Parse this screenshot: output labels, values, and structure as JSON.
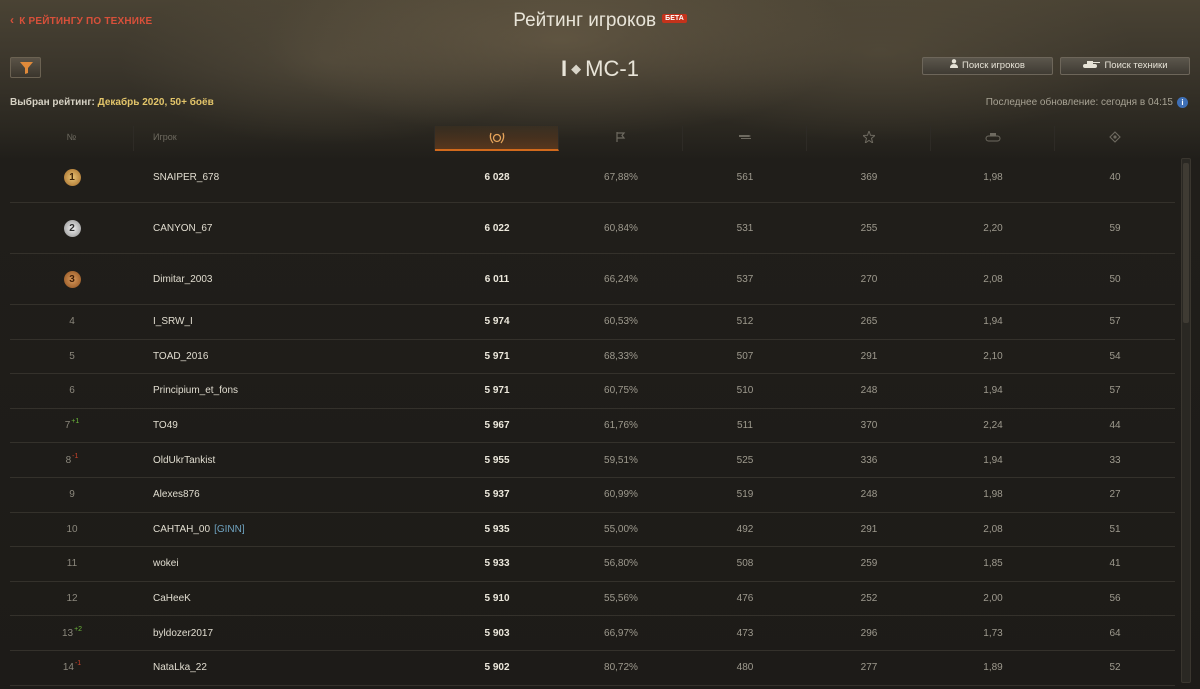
{
  "header": {
    "back_label": "К РЕЙТИНГУ ПО ТЕХНИКЕ",
    "title": "Рейтинг игроков",
    "beta": "БЕТА",
    "vehicle_tier": "I",
    "vehicle_name": "МС-1",
    "search_players": "Поиск игроков",
    "search_vehicles": "Поиск техники"
  },
  "info": {
    "chosen_label": "Выбран рейтинг:",
    "chosen_value": "Декабрь 2020, 50+ боёв",
    "updated": "Последнее обновление: сегодня в 04:15"
  },
  "columns": {
    "rank": "№",
    "player": "Игрок"
  },
  "colors": {
    "accent": "#d26a1c",
    "back_link": "#d8503a",
    "chosen_value": "#e3c56a",
    "rank_up": "#6cb83a",
    "rank_down": "#c9422b",
    "clan": "#6fa3c0"
  },
  "icons": {
    "rating_col": "rating-laurel-icon",
    "winrate_col": "flag-icon",
    "damage_col": "crossed-shells-icon",
    "exp_col": "star-icon",
    "kills_col": "tank-destroyed-icon",
    "assist_col": "spotting-icon"
  },
  "rows": [
    {
      "rank": "1",
      "medal": "g",
      "change": "",
      "dir": "",
      "name": "SNAIPER_678",
      "clan": "",
      "rating": "6 028",
      "winrate": "67,88%",
      "damage": "561",
      "exp": "369",
      "kills": "1,98",
      "assist": "40"
    },
    {
      "rank": "2",
      "medal": "s",
      "change": "",
      "dir": "",
      "name": "CANYON_67",
      "clan": "",
      "rating": "6 022",
      "winrate": "60,84%",
      "damage": "531",
      "exp": "255",
      "kills": "2,20",
      "assist": "59"
    },
    {
      "rank": "3",
      "medal": "b",
      "change": "",
      "dir": "",
      "name": "Dimitar_2003",
      "clan": "",
      "rating": "6 011",
      "winrate": "66,24%",
      "damage": "537",
      "exp": "270",
      "kills": "2,08",
      "assist": "50"
    },
    {
      "rank": "4",
      "medal": "",
      "change": "",
      "dir": "",
      "name": "I_SRW_I",
      "clan": "",
      "rating": "5 974",
      "winrate": "60,53%",
      "damage": "512",
      "exp": "265",
      "kills": "1,94",
      "assist": "57"
    },
    {
      "rank": "5",
      "medal": "",
      "change": "",
      "dir": "",
      "name": "TOAD_2016",
      "clan": "",
      "rating": "5 971",
      "winrate": "68,33%",
      "damage": "507",
      "exp": "291",
      "kills": "2,10",
      "assist": "54"
    },
    {
      "rank": "6",
      "medal": "",
      "change": "",
      "dir": "",
      "name": "Principium_et_fons",
      "clan": "",
      "rating": "5 971",
      "winrate": "60,75%",
      "damage": "510",
      "exp": "248",
      "kills": "1,94",
      "assist": "57"
    },
    {
      "rank": "7",
      "medal": "",
      "change": "+1",
      "dir": "up",
      "name": "TO49",
      "clan": "",
      "rating": "5 967",
      "winrate": "61,76%",
      "damage": "511",
      "exp": "370",
      "kills": "2,24",
      "assist": "44"
    },
    {
      "rank": "8",
      "medal": "",
      "change": "-1",
      "dir": "down",
      "name": "OldUkrTankist",
      "clan": "",
      "rating": "5 955",
      "winrate": "59,51%",
      "damage": "525",
      "exp": "336",
      "kills": "1,94",
      "assist": "33"
    },
    {
      "rank": "9",
      "medal": "",
      "change": "",
      "dir": "",
      "name": "Alexes876",
      "clan": "",
      "rating": "5 937",
      "winrate": "60,99%",
      "damage": "519",
      "exp": "248",
      "kills": "1,98",
      "assist": "27"
    },
    {
      "rank": "10",
      "medal": "",
      "change": "",
      "dir": "",
      "name": "CAHTAH_00",
      "clan": "[GINN]",
      "rating": "5 935",
      "winrate": "55,00%",
      "damage": "492",
      "exp": "291",
      "kills": "2,08",
      "assist": "51"
    },
    {
      "rank": "11",
      "medal": "",
      "change": "",
      "dir": "",
      "name": "wokei",
      "clan": "",
      "rating": "5 933",
      "winrate": "56,80%",
      "damage": "508",
      "exp": "259",
      "kills": "1,85",
      "assist": "41"
    },
    {
      "rank": "12",
      "medal": "",
      "change": "",
      "dir": "",
      "name": "CaHeeK",
      "clan": "",
      "rating": "5 910",
      "winrate": "55,56%",
      "damage": "476",
      "exp": "252",
      "kills": "2,00",
      "assist": "56"
    },
    {
      "rank": "13",
      "medal": "",
      "change": "+2",
      "dir": "up",
      "name": "byldozer2017",
      "clan": "",
      "rating": "5 903",
      "winrate": "66,97%",
      "damage": "473",
      "exp": "296",
      "kills": "1,73",
      "assist": "64"
    },
    {
      "rank": "14",
      "medal": "",
      "change": "-1",
      "dir": "down",
      "name": "NataLka_22",
      "clan": "",
      "rating": "5 902",
      "winrate": "80,72%",
      "damage": "480",
      "exp": "277",
      "kills": "1,89",
      "assist": "52"
    }
  ]
}
